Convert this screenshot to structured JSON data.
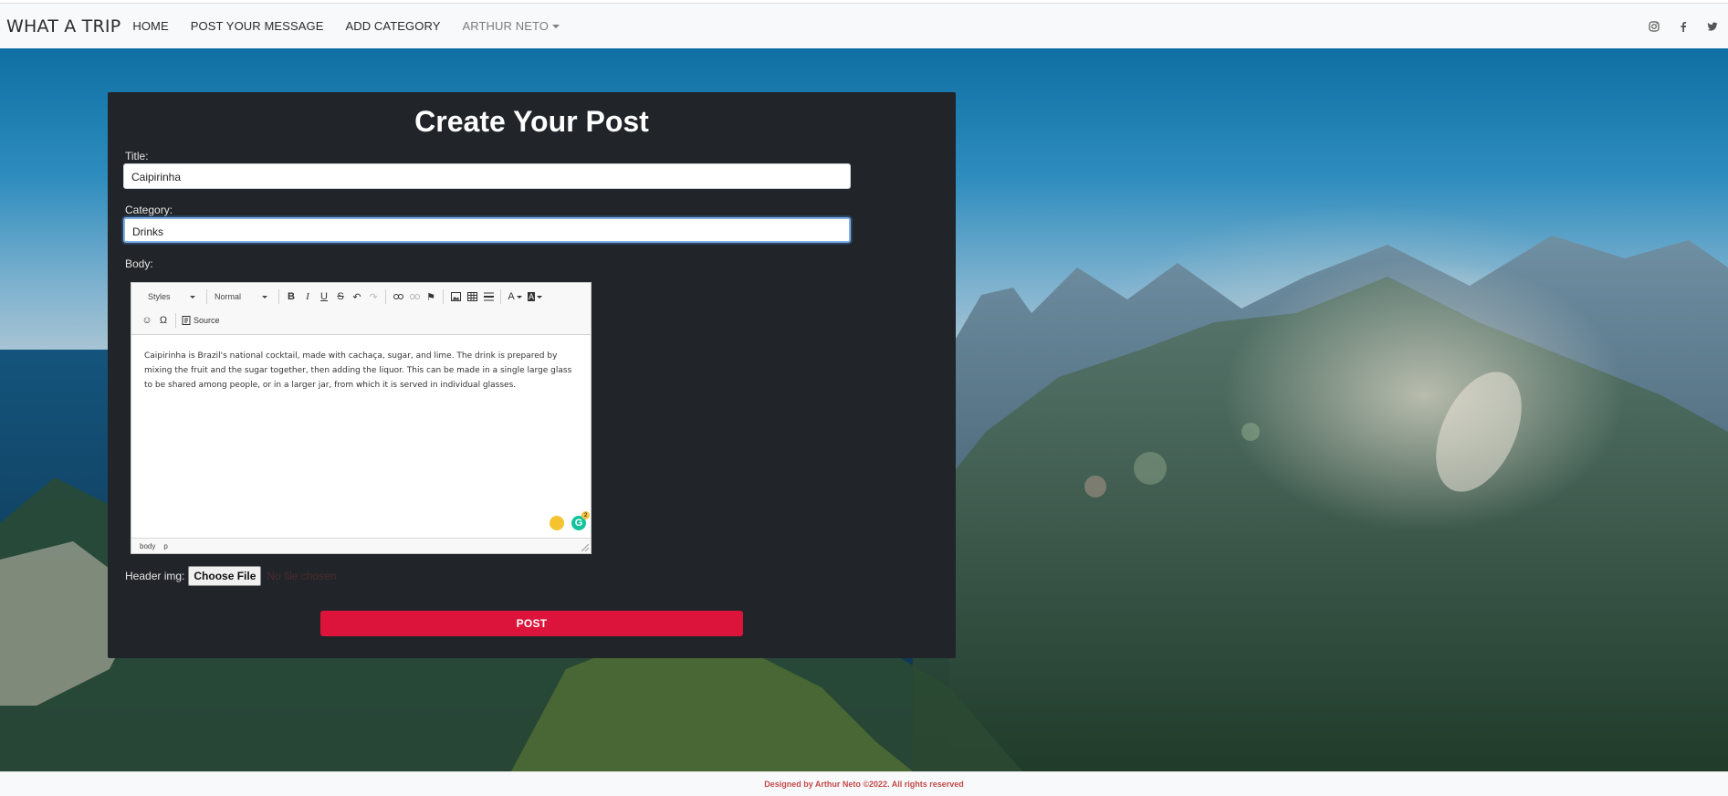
{
  "navbar": {
    "brand": "WHAT A TRIP",
    "links": [
      "HOME",
      "POST YOUR MESSAGE",
      "ADD CATEGORY"
    ],
    "user": "ARTHUR NETO",
    "social_icons": [
      "instagram-icon",
      "facebook-icon",
      "twitter-icon"
    ]
  },
  "form": {
    "title": "Create Your Post",
    "title_label": "Title:",
    "title_value": "Caipirinha",
    "category_label": "Category:",
    "category_value": "Drinks",
    "body_label": "Body:",
    "header_img_label": "Header img:",
    "choose_file_label": "Choose File",
    "no_file_text": "No file chosen",
    "submit_label": "POST"
  },
  "editor": {
    "styles_combo": "Styles",
    "format_combo": "Normal",
    "source_label": "Source",
    "content": "Caipirinha is Brazil's national cocktail, made with cachaça, sugar, and lime. The drink is prepared by mixing the fruit and the sugar together, then adding the liquor. This can be made in a single large glass to be shared among people, or in a larger jar, from which it is served in individual glasses.",
    "path": [
      "body",
      "p"
    ],
    "grammarly_count": "2"
  },
  "footer": {
    "text": "Designed by Arthur Neto ©2022. All rights reserved"
  },
  "colors": {
    "card_bg": "#212529",
    "accent": "#dc143c",
    "navbar_bg": "#f8f9fa",
    "footer_text": "#c24a4a"
  }
}
